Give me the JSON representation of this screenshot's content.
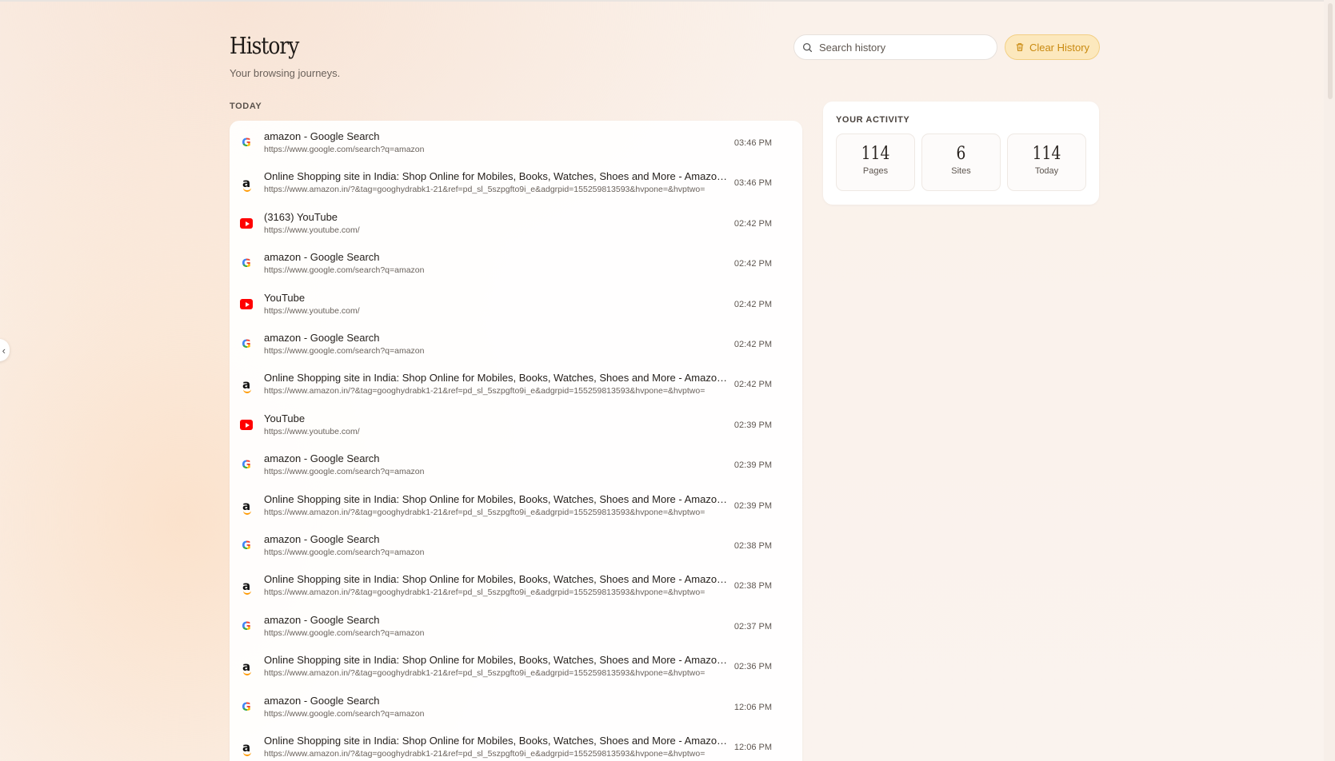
{
  "header": {
    "title": "History",
    "subtitle": "Your browsing journeys."
  },
  "search": {
    "placeholder": "Search history",
    "icon": "search-icon"
  },
  "clear_button": {
    "label": "Clear History",
    "icon": "trash-icon",
    "color": "#c98a10"
  },
  "section": {
    "label": "TODAY"
  },
  "activity": {
    "label": "YOUR ACTIVITY",
    "stats": [
      {
        "value": "114",
        "label": "Pages"
      },
      {
        "value": "6",
        "label": "Sites"
      },
      {
        "value": "114",
        "label": "Today"
      }
    ]
  },
  "history": [
    {
      "icon": "google",
      "title": "amazon - Google Search",
      "url": "https://www.google.com/search?q=amazon",
      "time": "03:46 PM"
    },
    {
      "icon": "amazon",
      "title": "Online Shopping site in India: Shop Online for Mobiles, Books, Watches, Shoes and More - Amazon.in",
      "url": "https://www.amazon.in/?&tag=googhydrabk1-21&ref=pd_sl_5szpgfto9i_e&adgrpid=155259813593&hvpone=&hvptwo=",
      "time": "03:46 PM"
    },
    {
      "icon": "youtube",
      "title": "(3163) YouTube",
      "url": "https://www.youtube.com/",
      "time": "02:42 PM"
    },
    {
      "icon": "google",
      "title": "amazon - Google Search",
      "url": "https://www.google.com/search?q=amazon",
      "time": "02:42 PM"
    },
    {
      "icon": "youtube",
      "title": "YouTube",
      "url": "https://www.youtube.com/",
      "time": "02:42 PM"
    },
    {
      "icon": "google",
      "title": "amazon - Google Search",
      "url": "https://www.google.com/search?q=amazon",
      "time": "02:42 PM"
    },
    {
      "icon": "amazon",
      "title": "Online Shopping site in India: Shop Online for Mobiles, Books, Watches, Shoes and More - Amazon.in",
      "url": "https://www.amazon.in/?&tag=googhydrabk1-21&ref=pd_sl_5szpgfto9i_e&adgrpid=155259813593&hvpone=&hvptwo=",
      "time": "02:42 PM"
    },
    {
      "icon": "youtube",
      "title": "YouTube",
      "url": "https://www.youtube.com/",
      "time": "02:39 PM"
    },
    {
      "icon": "google",
      "title": "amazon - Google Search",
      "url": "https://www.google.com/search?q=amazon",
      "time": "02:39 PM"
    },
    {
      "icon": "amazon",
      "title": "Online Shopping site in India: Shop Online for Mobiles, Books, Watches, Shoes and More - Amazon.in",
      "url": "https://www.amazon.in/?&tag=googhydrabk1-21&ref=pd_sl_5szpgfto9i_e&adgrpid=155259813593&hvpone=&hvptwo=",
      "time": "02:39 PM"
    },
    {
      "icon": "google",
      "title": "amazon - Google Search",
      "url": "https://www.google.com/search?q=amazon",
      "time": "02:38 PM"
    },
    {
      "icon": "amazon",
      "title": "Online Shopping site in India: Shop Online for Mobiles, Books, Watches, Shoes and More - Amazon.in",
      "url": "https://www.amazon.in/?&tag=googhydrabk1-21&ref=pd_sl_5szpgfto9i_e&adgrpid=155259813593&hvpone=&hvptwo=",
      "time": "02:38 PM"
    },
    {
      "icon": "google",
      "title": "amazon - Google Search",
      "url": "https://www.google.com/search?q=amazon",
      "time": "02:37 PM"
    },
    {
      "icon": "amazon",
      "title": "Online Shopping site in India: Shop Online for Mobiles, Books, Watches, Shoes and More - Amazon.in",
      "url": "https://www.amazon.in/?&tag=googhydrabk1-21&ref=pd_sl_5szpgfto9i_e&adgrpid=155259813593&hvpone=&hvptwo=",
      "time": "02:36 PM"
    },
    {
      "icon": "google",
      "title": "amazon - Google Search",
      "url": "https://www.google.com/search?q=amazon",
      "time": "12:06 PM"
    },
    {
      "icon": "amazon",
      "title": "Online Shopping site in India: Shop Online for Mobiles, Books, Watches, Shoes and More - Amazon.in",
      "url": "https://www.amazon.in/?&tag=googhydrabk1-21&ref=pd_sl_5szpgfto9i_e&adgrpid=155259813593&hvpone=&hvptwo=",
      "time": "12:06 PM"
    }
  ]
}
